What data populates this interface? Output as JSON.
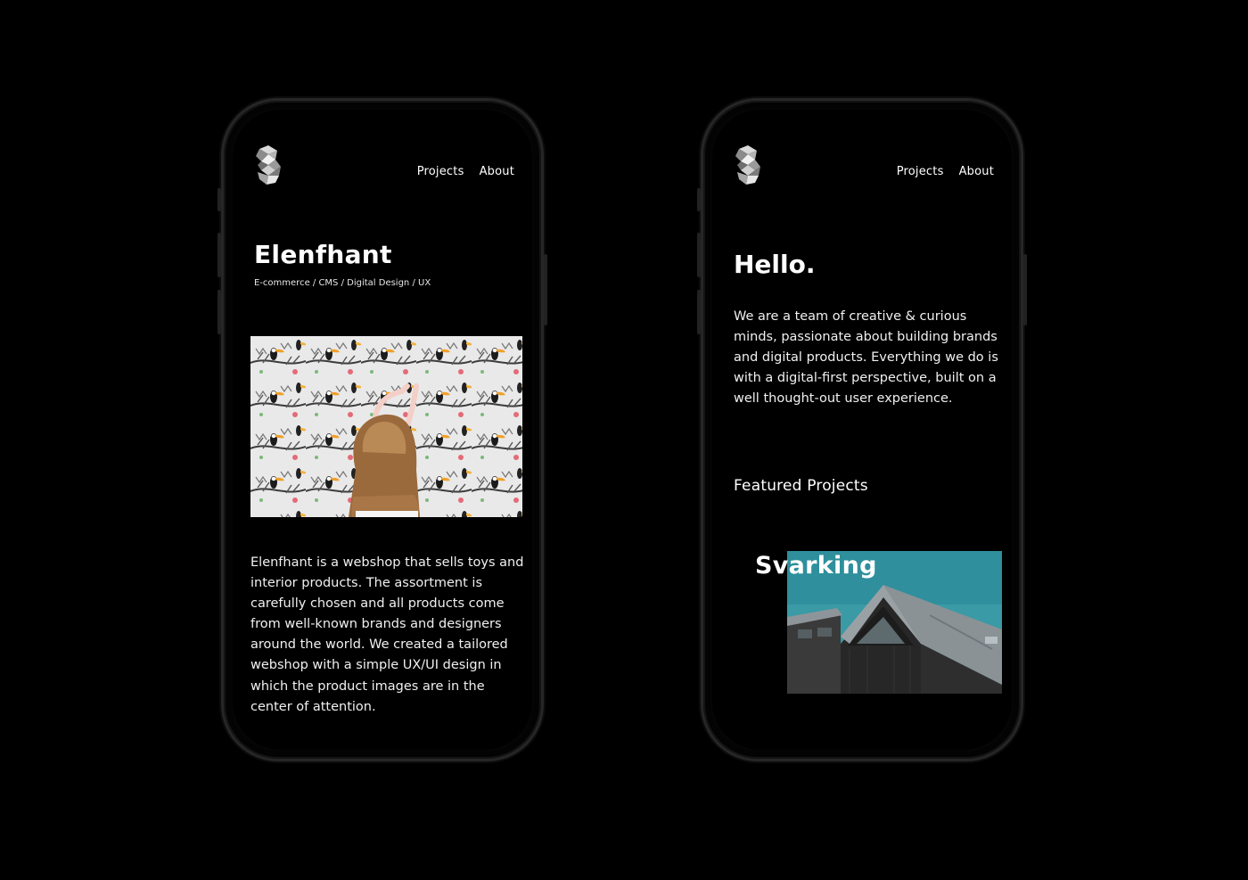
{
  "phones": [
    {
      "nav": {
        "projects": "Projects",
        "about": "About"
      },
      "project": {
        "title": "Elenfhant",
        "tags": "E-commerce / CMS / Digital Design / UX",
        "description": "Elenfhant is a webshop that sells toys and interior products. The assortment is carefully chosen and all products come from well-known brands and designers around the world. We created a tailored webshop with a simple UX/UI design in which the product images are in the center of attention."
      }
    },
    {
      "nav": {
        "projects": "Projects",
        "about": "About"
      },
      "hello": "Hello.",
      "about_text": "We are a team of creative & curious minds, passionate about building brands and digital products. Everything we do is with a digital-first perspective, built on a well thought-out user experience.",
      "featured_label": "Featured Projects",
      "featured_project": {
        "title": "Svarking"
      }
    }
  ],
  "colors": {
    "background": "#000000",
    "text": "#ffffff",
    "sky": "#3a9aa6",
    "house": "#2a2a2a"
  },
  "icons": [
    "logo-icon"
  ]
}
